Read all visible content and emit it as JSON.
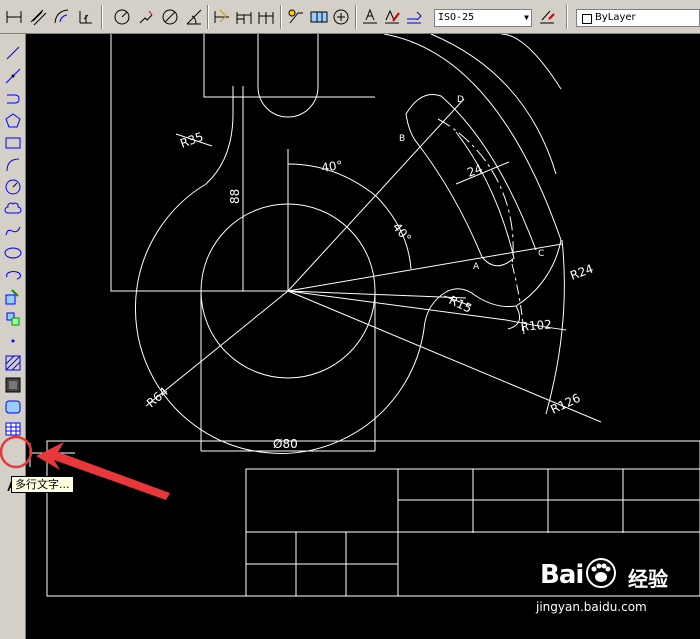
{
  "toolbar": {
    "dimension_style": "ISO-25",
    "layer": "ByLayer"
  },
  "tooltip": {
    "text": "多行文字..."
  },
  "text_tool": {
    "glyph": "A"
  },
  "drawing": {
    "labels": {
      "r35": "R35",
      "dim88": "88",
      "angle1": "40°",
      "angle2": "40°",
      "dim24": "24",
      "pt_a": "A",
      "pt_b": "B",
      "pt_c": "C",
      "pt_d": "D",
      "r24": "R24",
      "r15": "R15",
      "r102": "R102",
      "r64": "R64",
      "r126": "R126",
      "dia80": "Ø80"
    }
  },
  "watermark": {
    "brand": "Bai",
    "brand_cn": "经验",
    "url": "jingyan.baidu.com"
  },
  "colors": {
    "canvas": "#000000",
    "lines": "#ffffff",
    "highlight": "#e8383a",
    "ui": "#d4d0c8"
  }
}
